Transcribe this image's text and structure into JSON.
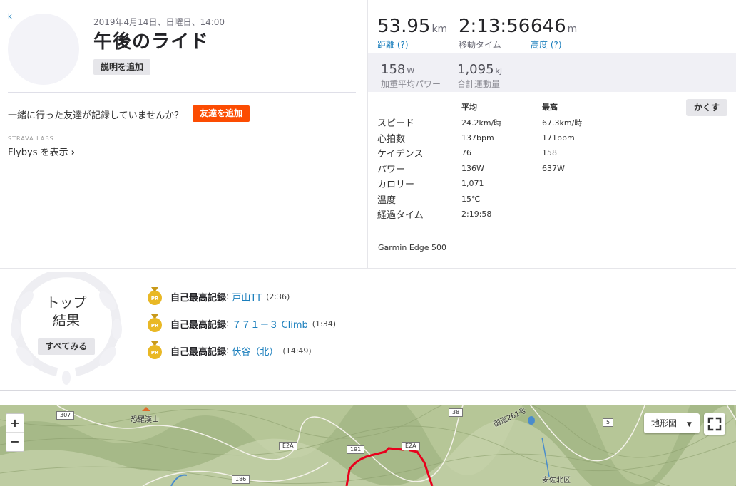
{
  "activity": {
    "date": "2019年4月14日、日曜日、14:00",
    "title": "午後のライド",
    "add_description": "説明を追加",
    "avatar_mark": "k"
  },
  "friends": {
    "question": "一緒に行った友達が記録していませんか？",
    "add_friends": "友達を追加"
  },
  "labs": {
    "label": "STRAVA LABS",
    "flybys": "Flybys を表示"
  },
  "primary_stats": [
    {
      "value": "53.95",
      "unit": "km",
      "label": "距離 (?)"
    },
    {
      "value": "2:13:56",
      "unit": "",
      "label": "移動タイム"
    },
    {
      "value": "646",
      "unit": "m",
      "label": "高度 (?)"
    }
  ],
  "secondary_stats": [
    {
      "value": "158",
      "unit": "W",
      "label": "加重平均パワー"
    },
    {
      "value": "1,095",
      "unit": "kJ",
      "label": "合計運動量"
    }
  ],
  "more_stats": {
    "hide_button": "かくす",
    "headers": [
      "",
      "平均",
      "最高"
    ],
    "rows": [
      [
        "スピード",
        "24.2km/時",
        "67.3km/時"
      ],
      [
        "心拍数",
        "137bpm",
        "171bpm"
      ],
      [
        "ケイデンス",
        "76",
        "158"
      ],
      [
        "パワー",
        "136W",
        "637W"
      ],
      [
        "カロリー",
        "1,071",
        ""
      ],
      [
        "温度",
        "15℃",
        ""
      ],
      [
        "経過タイム",
        "2:19:58",
        ""
      ]
    ],
    "device": "Garmin Edge 500"
  },
  "top_results": {
    "title_line1": "トップ",
    "title_line2": "結果",
    "see_all": "すべてみる",
    "achievements": [
      {
        "label": "自己最高記録",
        "segment": "戸山TT",
        "time": "(2:36)"
      },
      {
        "label": "自己最高記録",
        "segment": "７７１－３ Climb",
        "time": "(1:34)"
      },
      {
        "label": "自己最高記録",
        "segment": "伏谷（北）",
        "time": "(14:49)"
      }
    ],
    "medal_text": "PR"
  },
  "map": {
    "zoom_in": "+",
    "zoom_out": "−",
    "map_type": "地形図",
    "route_color": "#e8001c",
    "labels": {
      "mountain": "恐羅漢山",
      "road": "国道261号",
      "district": "安佐北区"
    },
    "shields": [
      "307",
      "38",
      "5",
      "E2A",
      "191",
      "E2A",
      "186"
    ]
  },
  "colors": {
    "accent": "#fc4c02",
    "link": "#1b7fbd",
    "medal": "#e9b825"
  }
}
